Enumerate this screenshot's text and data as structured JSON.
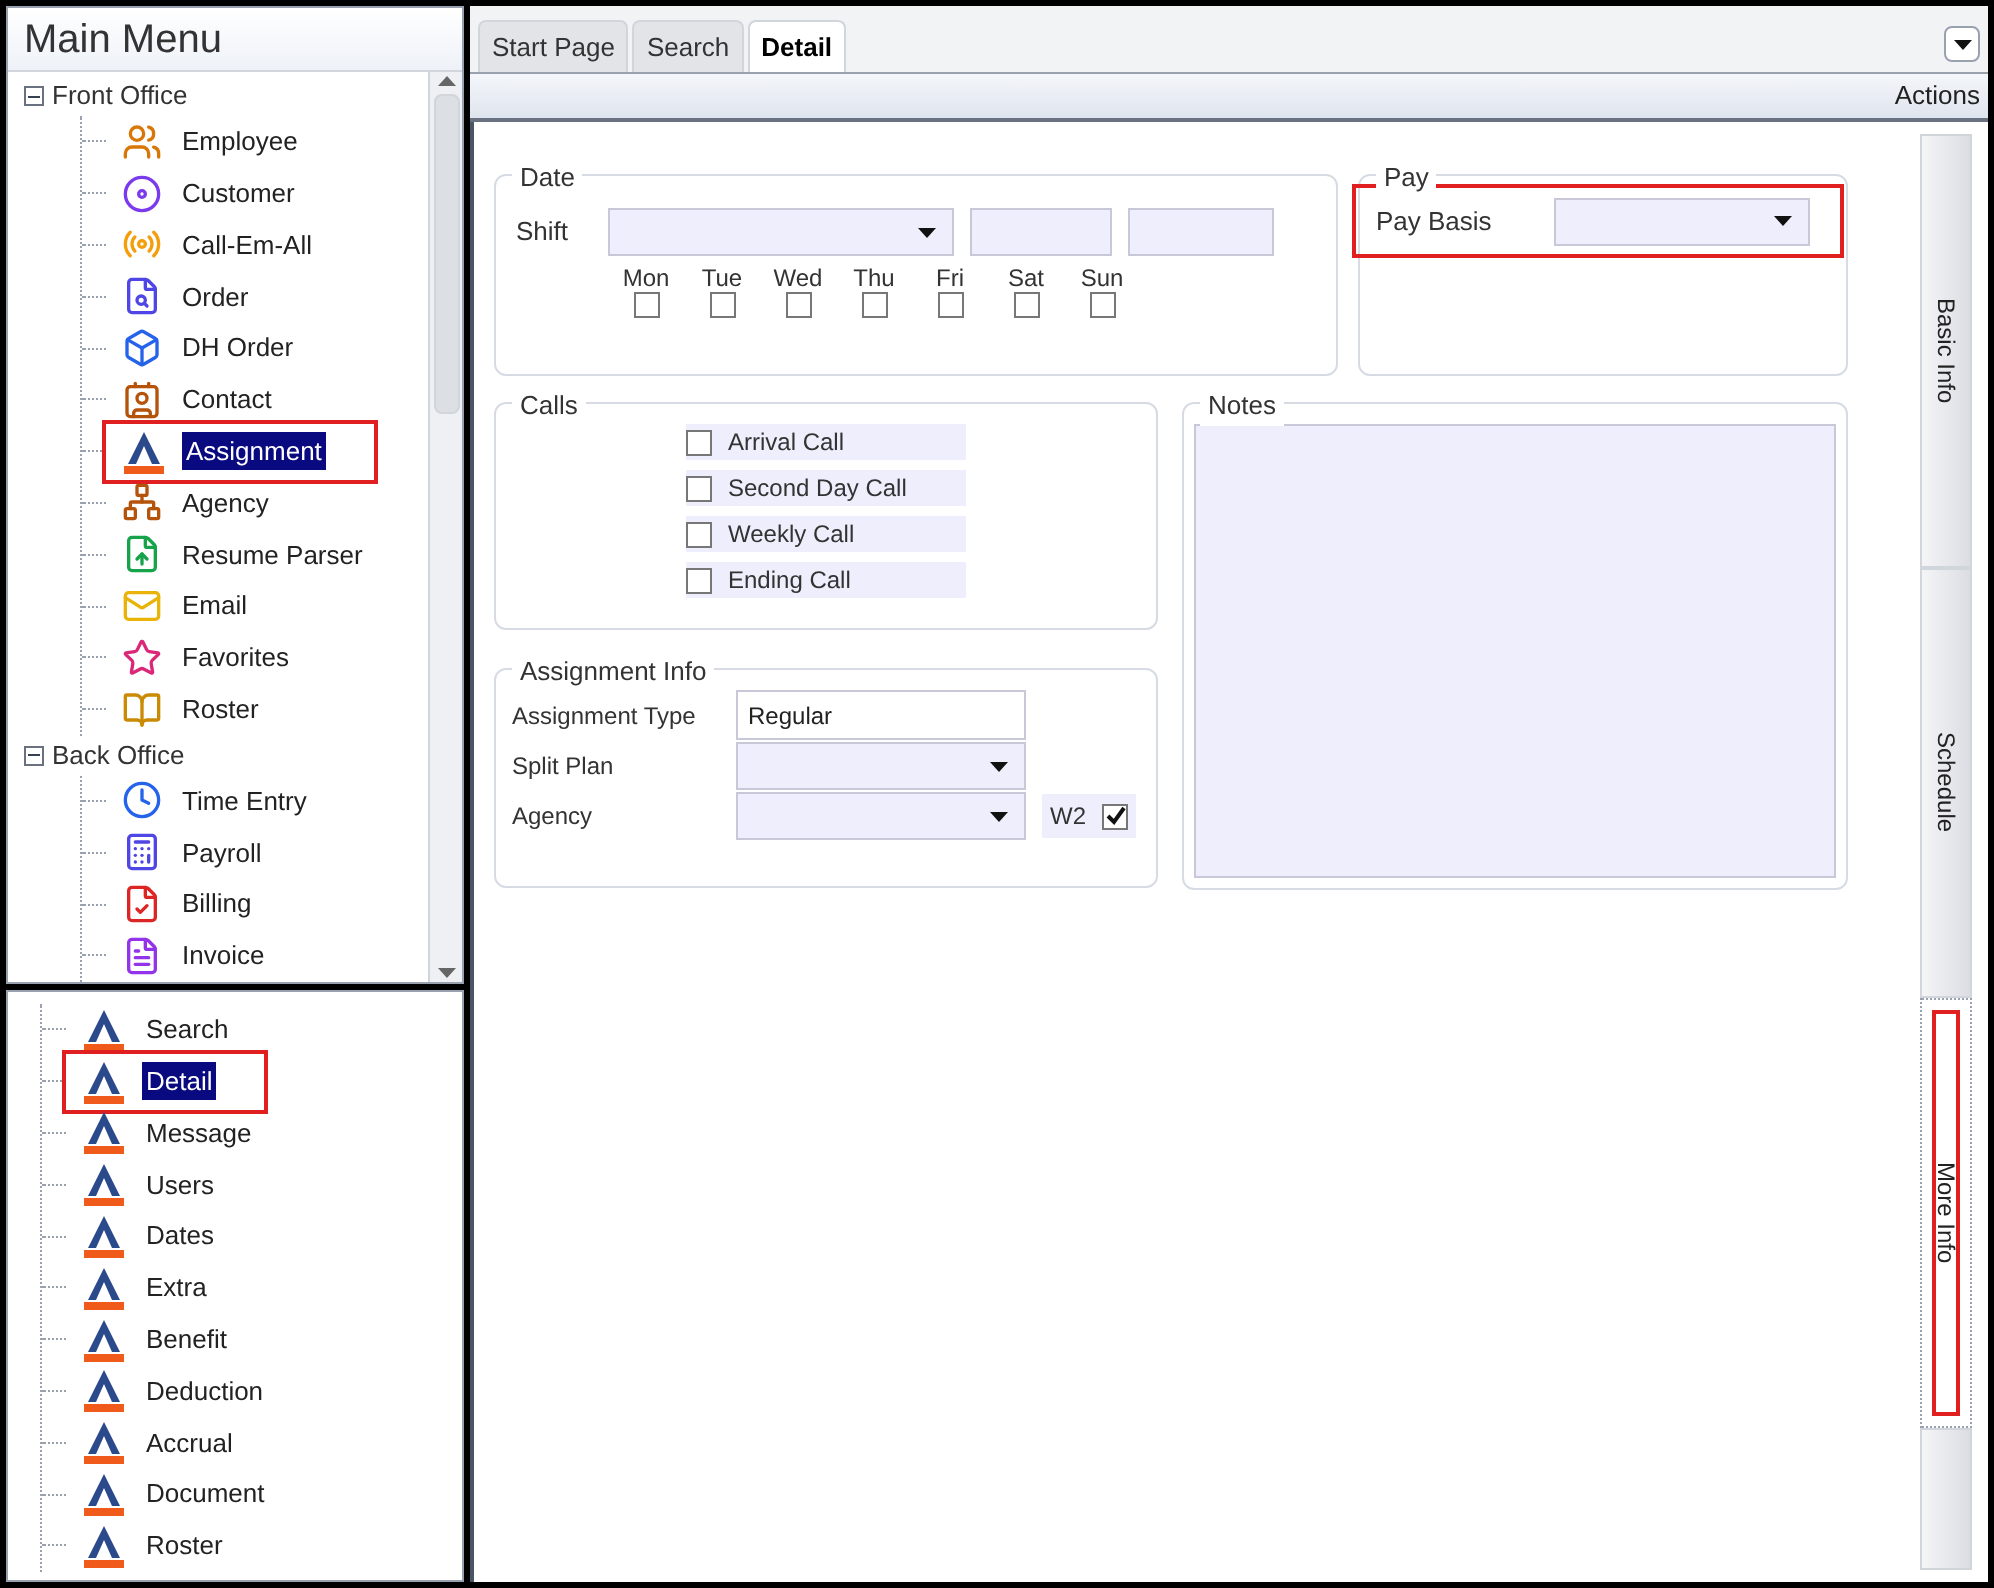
{
  "sidebar": {
    "title": "Main Menu",
    "groups": [
      {
        "label": "Front Office",
        "expanded": true,
        "items": [
          {
            "label": "Employee",
            "selected": false,
            "highlighted": false
          },
          {
            "label": "Customer",
            "selected": false,
            "highlighted": false
          },
          {
            "label": "Call-Em-All",
            "selected": false,
            "highlighted": false
          },
          {
            "label": "Order",
            "selected": false,
            "highlighted": false
          },
          {
            "label": "DH Order",
            "selected": false,
            "highlighted": false
          },
          {
            "label": "Contact",
            "selected": false,
            "highlighted": false
          },
          {
            "label": "Assignment",
            "selected": true,
            "highlighted": true
          },
          {
            "label": "Agency",
            "selected": false,
            "highlighted": false
          },
          {
            "label": "Resume Parser",
            "selected": false,
            "highlighted": false
          },
          {
            "label": "Email",
            "selected": false,
            "highlighted": false
          },
          {
            "label": "Favorites",
            "selected": false,
            "highlighted": false
          },
          {
            "label": "Roster",
            "selected": false,
            "highlighted": false
          }
        ]
      },
      {
        "label": "Back Office",
        "expanded": true,
        "items": [
          {
            "label": "Time Entry",
            "selected": false,
            "highlighted": false
          },
          {
            "label": "Payroll",
            "selected": false,
            "highlighted": false
          },
          {
            "label": "Billing",
            "selected": false,
            "highlighted": false
          },
          {
            "label": "Invoice",
            "selected": false,
            "highlighted": false
          }
        ]
      }
    ],
    "subitems": [
      {
        "label": "Search",
        "selected": false,
        "highlighted": false
      },
      {
        "label": "Detail",
        "selected": true,
        "highlighted": true
      },
      {
        "label": "Message",
        "selected": false,
        "highlighted": false
      },
      {
        "label": "Users",
        "selected": false,
        "highlighted": false
      },
      {
        "label": "Dates",
        "selected": false,
        "highlighted": false
      },
      {
        "label": "Extra",
        "selected": false,
        "highlighted": false
      },
      {
        "label": "Benefit",
        "selected": false,
        "highlighted": false
      },
      {
        "label": "Deduction",
        "selected": false,
        "highlighted": false
      },
      {
        "label": "Accrual",
        "selected": false,
        "highlighted": false
      },
      {
        "label": "Document",
        "selected": false,
        "highlighted": false
      },
      {
        "label": "Roster",
        "selected": false,
        "highlighted": false
      }
    ]
  },
  "tabs": [
    {
      "label": "Start Page",
      "selected": false
    },
    {
      "label": "Search",
      "selected": false
    },
    {
      "label": "Detail",
      "selected": true
    }
  ],
  "actions_label": "Actions",
  "date": {
    "title": "Date",
    "shift_label": "Shift",
    "days": [
      {
        "label": "Mon",
        "checked": false
      },
      {
        "label": "Tue",
        "checked": false
      },
      {
        "label": "Wed",
        "checked": false
      },
      {
        "label": "Thu",
        "checked": false
      },
      {
        "label": "Fri",
        "checked": false
      },
      {
        "label": "Sat",
        "checked": false
      },
      {
        "label": "Sun",
        "checked": false
      }
    ]
  },
  "pay": {
    "title": "Pay",
    "label": "Pay Basis",
    "highlighted": true
  },
  "calls": {
    "title": "Calls",
    "items": [
      {
        "label": "Arrival Call",
        "checked": false
      },
      {
        "label": "Second Day Call",
        "checked": false
      },
      {
        "label": "Weekly Call",
        "checked": false
      },
      {
        "label": "Ending Call",
        "checked": false
      }
    ]
  },
  "notes": {
    "title": "Notes"
  },
  "assignment_info": {
    "title": "Assignment Info",
    "type_label": "Assignment Type",
    "type_value": "Regular",
    "split_label": "Split Plan",
    "agency_label": "Agency",
    "w2_label": "W2",
    "w2_checked": true
  },
  "side_tabs": [
    {
      "label": "Basic Info",
      "selected": false,
      "highlighted": false
    },
    {
      "label": "Schedule",
      "selected": false,
      "highlighted": false
    },
    {
      "label": "More Info",
      "selected": true,
      "highlighted": true
    }
  ]
}
